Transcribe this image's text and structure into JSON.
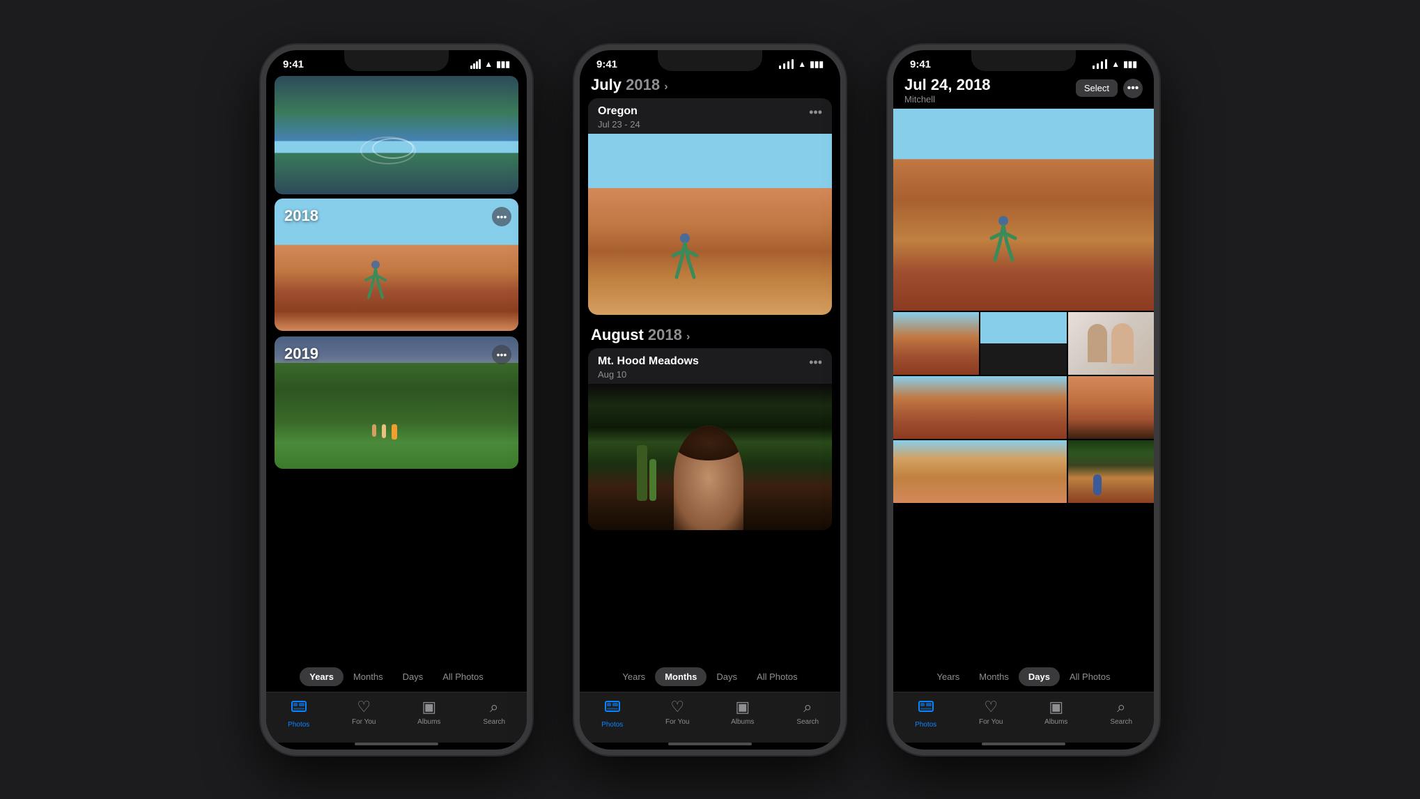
{
  "phones": [
    {
      "id": "phone-years",
      "status": {
        "time": "9:41",
        "signal": true,
        "wifi": true,
        "battery": true
      },
      "view": "years",
      "years": [
        {
          "label": "2018",
          "scene": "desert"
        },
        {
          "label": "2019",
          "scene": "meadow"
        }
      ],
      "segments": [
        "Years",
        "Months",
        "Days",
        "All Photos"
      ],
      "activeSegment": "Years",
      "tabs": [
        {
          "label": "Photos",
          "icon": "⊞",
          "active": true
        },
        {
          "label": "For You",
          "icon": "♡",
          "active": false
        },
        {
          "label": "Albums",
          "icon": "▣",
          "active": false
        },
        {
          "label": "Search",
          "icon": "⌕",
          "active": false
        }
      ]
    },
    {
      "id": "phone-months",
      "status": {
        "time": "9:41",
        "signal": true,
        "wifi": true,
        "battery": true
      },
      "view": "months",
      "sections": [
        {
          "month": "July",
          "year": "2018",
          "events": [
            {
              "title": "Oregon",
              "date": "Jul 23 - 24",
              "scene": "oregon"
            }
          ]
        },
        {
          "month": "August",
          "year": "2018",
          "events": [
            {
              "title": "Mt. Hood Meadows",
              "date": "Aug 10",
              "scene": "mthhood"
            }
          ]
        }
      ],
      "segments": [
        "Years",
        "Months",
        "Days",
        "All Photos"
      ],
      "activeSegment": "Months",
      "tabs": [
        {
          "label": "Photos",
          "icon": "⊞",
          "active": true
        },
        {
          "label": "For You",
          "icon": "♡",
          "active": false
        },
        {
          "label": "Albums",
          "icon": "▣",
          "active": false
        },
        {
          "label": "Search",
          "icon": "⌕",
          "active": false
        }
      ]
    },
    {
      "id": "phone-days",
      "status": {
        "time": "9:41",
        "signal": true,
        "wifi": true,
        "battery": true
      },
      "view": "days",
      "dayInfo": {
        "date": "Jul 24, 2018",
        "location": "Mitchell"
      },
      "actions": {
        "select": "Select",
        "more": "..."
      },
      "segments": [
        "Years",
        "Months",
        "Days",
        "All Photos"
      ],
      "activeSegment": "Days",
      "tabs": [
        {
          "label": "Photos",
          "icon": "⊞",
          "active": true
        },
        {
          "label": "For You",
          "icon": "♡",
          "active": false
        },
        {
          "label": "Albums",
          "icon": "▣",
          "active": false
        },
        {
          "label": "Search",
          "icon": "⌕",
          "active": false
        }
      ]
    }
  ],
  "tabLabels": {
    "photos": "Photos",
    "forYou": "For You",
    "albums": "Albums",
    "search": "Search"
  }
}
